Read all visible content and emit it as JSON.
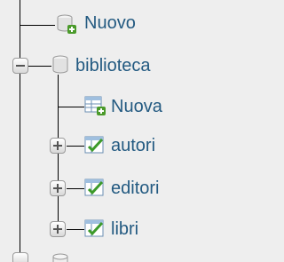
{
  "tree": {
    "items": [
      {
        "label": "Nuovo",
        "icon": "database-new-icon"
      },
      {
        "label": "biblioteca",
        "icon": "database-icon",
        "expanded": true,
        "children": [
          {
            "label": "Nuova",
            "icon": "table-new-icon"
          },
          {
            "label": "autori",
            "icon": "table-icon",
            "expanded": false
          },
          {
            "label": "editori",
            "icon": "table-icon",
            "expanded": false
          },
          {
            "label": "libri",
            "icon": "table-icon",
            "expanded": false
          }
        ]
      }
    ]
  },
  "colors": {
    "link": "#235a81",
    "background": "#eeeeee"
  }
}
